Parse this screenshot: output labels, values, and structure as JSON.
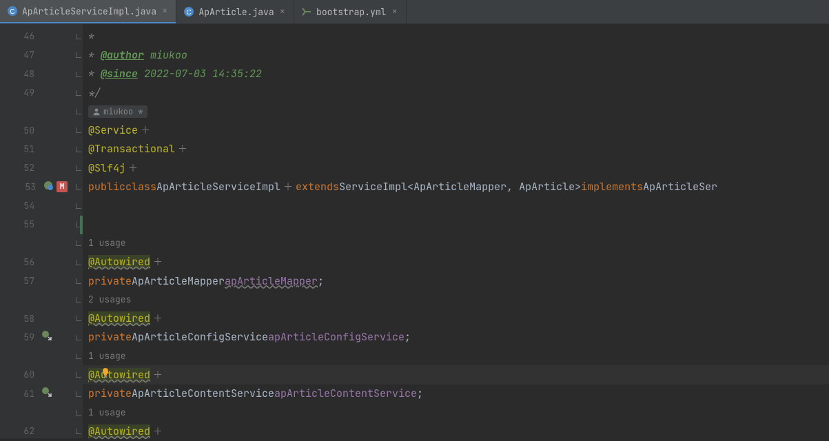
{
  "tabs": [
    {
      "label": "ApArticleServiceImpl.java",
      "active": true,
      "icon": "java-class"
    },
    {
      "label": "ApArticle.java",
      "active": false,
      "icon": "java-class"
    },
    {
      "label": "bootstrap.yml",
      "active": false,
      "icon": "yml"
    }
  ],
  "code": {
    "l46": {
      "num": "46",
      "star": "*"
    },
    "l47": {
      "num": "47",
      "star": "* ",
      "tag": "@author",
      "txt": " miukoo"
    },
    "l48": {
      "num": "48",
      "star": "* ",
      "tag": "@since",
      "txt": " 2022-07-03 14:35:22"
    },
    "l49": {
      "num": "49",
      "close": "*/"
    },
    "author_chip": {
      "name": "miukoo *"
    },
    "l50": {
      "num": "50",
      "anno": "@Service"
    },
    "l51": {
      "num": "51",
      "anno": "@Transactional"
    },
    "l52": {
      "num": "52",
      "anno": "@Slf4j"
    },
    "l53": {
      "num": "53",
      "kw1": "public",
      "kw2": "class",
      "cls": "ApArticleServiceImpl",
      "kw3": "extends",
      "ext": "ServiceImpl<ApArticleMapper, ApArticle>",
      "kw4": "implements",
      "impl": "ApArticleSer"
    },
    "l54": {
      "num": "54"
    },
    "l55": {
      "num": "55"
    },
    "h1": {
      "txt": "1 usage"
    },
    "l56": {
      "num": "56",
      "anno": "Autowired"
    },
    "l57": {
      "num": "57",
      "kw": "private",
      "type": "ApArticleMapper",
      "field": "apArticleMapper",
      "semi": ";"
    },
    "h2": {
      "txt": "2 usages"
    },
    "l58": {
      "num": "58",
      "anno": "Autowired"
    },
    "l59": {
      "num": "59",
      "kw": "private",
      "type": "ApArticleConfigService",
      "field": "apArticleConfigService",
      "semi": ";"
    },
    "h3": {
      "txt": "1 usage"
    },
    "l60": {
      "num": "60",
      "anno": "Autowired"
    },
    "l61": {
      "num": "61",
      "kw": "private",
      "type": "ApArticleContentService",
      "field": "apArticleContentService",
      "semi": ";"
    },
    "h4": {
      "txt": "1 usage"
    },
    "l62": {
      "num": "62",
      "anno": "Autowired"
    }
  }
}
